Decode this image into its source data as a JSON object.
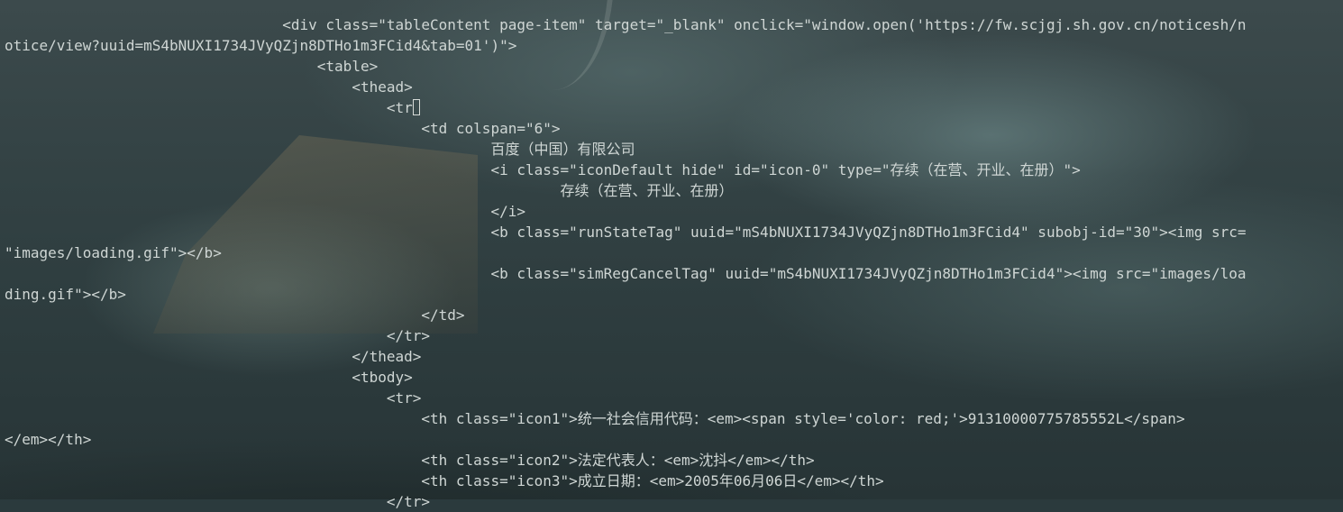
{
  "editor": {
    "lines": [
      "                                <div class=\"tableContent page-item\" target=\"_blank\" onclick=\"window.open('https://fw.scjgj.sh.gov.cn/noticesh/n",
      "otice/view?uuid=mS4bNUXI1734JVyQZjn8DTHo1m3FCid4&tab=01')\">",
      "                                    <table>",
      "                                        <thead>",
      "                                            <tr>",
      "                                                <td colspan=\"6\">",
      "                                                        百度（中国）有限公司",
      "                                                        <i class=\"iconDefault hide\" id=\"icon-0\" type=\"存续（在营、开业、在册）\">",
      "                                                                存续（在营、开业、在册）",
      "                                                        </i>",
      "                                                        <b class=\"runStateTag\" uuid=\"mS4bNUXI1734JVyQZjn8DTHo1m3FCid4\" subobj-id=\"30\"><img src=",
      "\"images/loading.gif\"></b>",
      "",
      "                                                        <b class=\"simRegCancelTag\" uuid=\"mS4bNUXI1734JVyQZjn8DTHo1m3FCid4\"><img src=\"images/loa",
      "ding.gif\"></b>",
      "",
      "                                                </td>",
      "                                            </tr>",
      "                                        </thead>",
      "                                        <tbody>",
      "                                            <tr>",
      "                                                <th class=\"icon1\">统一社会信用代码：<em><span style='color: red;'>91310000775785552L</span>",
      "</em></th>",
      "",
      "                                                <th class=\"icon2\">法定代表人：<em>沈抖</em></th>",
      "                                                <th class=\"icon3\">成立日期：<em>2005年06月06日</em></th>",
      "                                            </tr>"
    ],
    "cursor_line": 4
  }
}
